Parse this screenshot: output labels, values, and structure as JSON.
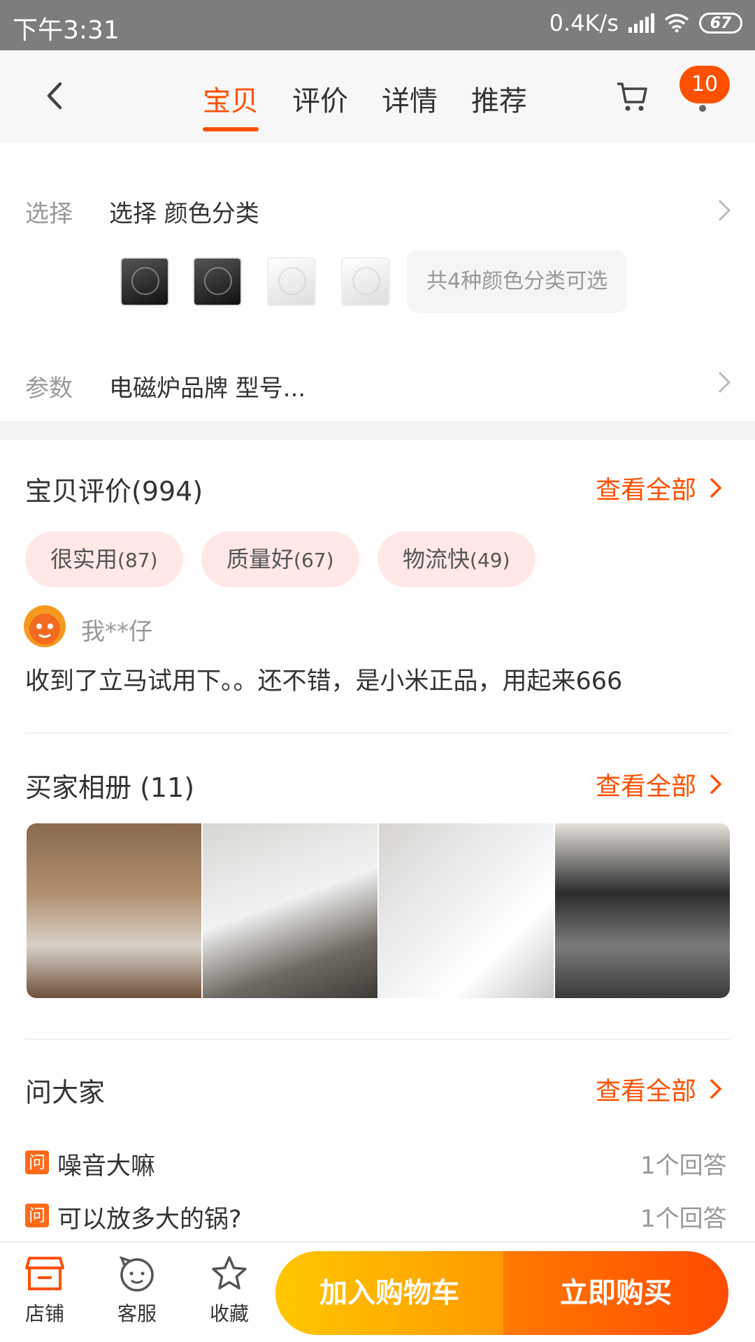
{
  "status_bar": {
    "time": "下午3:31",
    "net_speed": "0.4K/s",
    "battery": "67"
  },
  "nav": {
    "tabs": [
      "宝贝",
      "评价",
      "详情",
      "推荐"
    ],
    "active_tab": "宝贝",
    "cart_badge": "10"
  },
  "select_row": {
    "label": "选择",
    "value": "选择 颜色分类"
  },
  "color_thumbs": [
    {
      "name": "color-black-1",
      "tone": "black"
    },
    {
      "name": "color-black-2",
      "tone": "black"
    },
    {
      "name": "color-white-1",
      "tone": "white"
    },
    {
      "name": "color-white-2",
      "tone": "white"
    }
  ],
  "color_count_text": "共4种颜色分类可选",
  "params_row": {
    "label": "参数",
    "value": "电磁炉品牌 型号..."
  },
  "reviews": {
    "title": "宝贝评价(994)",
    "see_all": "查看全部",
    "tags": [
      {
        "label": "很实用",
        "count": "(87)"
      },
      {
        "label": "质量好",
        "count": "(67)"
      },
      {
        "label": "物流快",
        "count": "(49)"
      }
    ],
    "reviewer": "我**仔",
    "text": "收到了立马试用下。。还不错，是小米正品，用起来666"
  },
  "album": {
    "title": "买家相册 (11)",
    "see_all": "查看全部"
  },
  "qa": {
    "title": "问大家",
    "see_all": "查看全部",
    "icon_char": "问",
    "items": [
      {
        "question": "噪音大嘛",
        "answers": "1个回答"
      },
      {
        "question": "可以放多大的锅?",
        "answers": "1个回答"
      }
    ]
  },
  "bottom_bar": {
    "store": "店铺",
    "service": "客服",
    "favorite": "收藏",
    "add_to_cart": "加入购物车",
    "buy_now": "立即购买"
  },
  "colors": {
    "accent": "#ff5000",
    "status_bar": "#7d7d7d"
  }
}
